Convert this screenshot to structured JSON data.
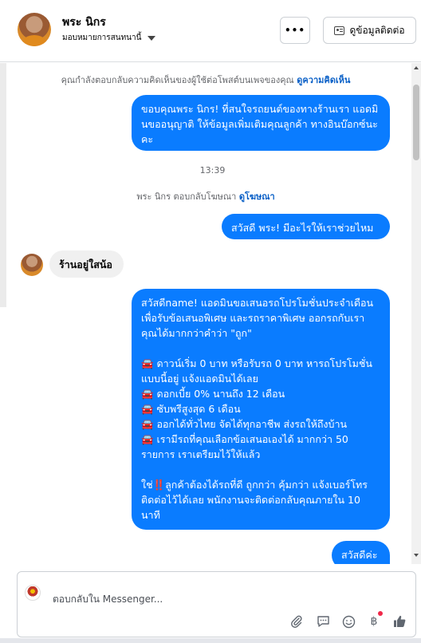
{
  "header": {
    "name": "พระ นิกร",
    "assign_label": "มอบหมายการสนทนานี้",
    "more_label": "•••",
    "contact_label": "ดูข้อมูลติดต่อ"
  },
  "conversation": {
    "notice_text": "คุณกำลังตอบกลับความคิดเห็นของผู้ใช้ต่อโพสต์บนเพจของคุณ",
    "notice_link": "ดูความคิดเห็น",
    "msg1": "ขอบคุณพระ นิกร! ที่สนใจรถยนต์ของทางร้านเรา แอดมินขออนุญาติ ให้ข้อมูลเพิ่มเติมคุณลูกค้า ทางอินบ๊อกซ์นะคะ",
    "time": "13:39",
    "reply_note_text": "พระ นิกร ตอบกลับโฆษณา",
    "reply_note_link": "ดูโฆษณา",
    "msg2": "สวัสดี พระ! มีอะไรให้เราช่วยไหม",
    "msg3": "ร้านอยู่ใสน้อ",
    "msg4": "สวัสดีname! แอดมินขอเสนอรถโปรโมชั่นประจำเดือน เพื่อรับข้อเสนอพิเศษ และรถราคาพิเศษ ออกรถกับเรา คุณได้มากกว่าคำว่า \"ถูก\"\n\n🚘 ดาวน์เริ่ม 0 บาท หรือรับรถ 0 บาท หารถโปรโมชั่นแบบนี้อยู่ แจ้งแอดมินได้เลย\n🚘 ดอกเบี้ย 0% นานถึง 12 เดือน\n🚘 ซับพรีสูงสุด 6 เดือน\n🚘 ออกได้ทั่วไทย จัดได้ทุกอาชีพ ส่งรถให้ถึงบ้าน\n🚘 เรามีรถที่คุณเลือกข้อเสนอเองได้ มากกว่า 50 รายการ เราเตรียมไว้ให้แล้ว\n\nใช่‼️ลูกค้าต้องได้รถที่ดี ถูกกว่า คุ้มกว่า แจ้งเบอร์โทรติดต่อไว้ได้เลย พนักงานจะติดต่อกลับคุณภายใน 10 นาที",
    "msg5": "สวัสดีค่ะ"
  },
  "composer": {
    "placeholder": "ตอบกลับใน Messenger...",
    "icons": [
      "attach-icon",
      "reply-icon",
      "emoji-icon",
      "currency-icon",
      "like-icon"
    ]
  },
  "colors": {
    "outgoing_bubble": "#0a7cff",
    "incoming_bubble": "#f0f0f0",
    "link": "#0a60c7"
  }
}
